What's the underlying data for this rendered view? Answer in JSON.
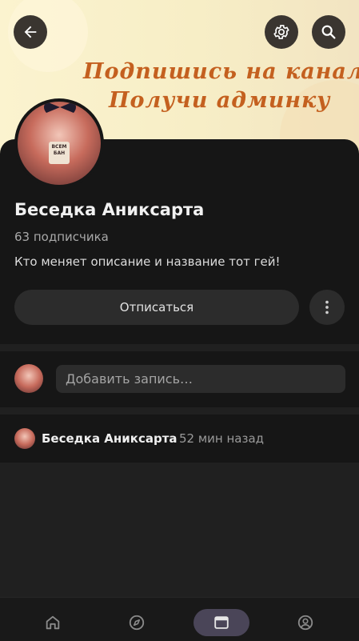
{
  "cover": {
    "line1": "Подпишись на канал",
    "line2": "Получи админку",
    "accent_color": "#c4601f"
  },
  "header": {
    "back_icon": "arrow-left-icon",
    "settings_icon": "gear-icon",
    "search_icon": "search-icon"
  },
  "profile": {
    "avatar_sign": "ВСЕМ БАН",
    "title": "Беседка Аниксарта",
    "subscribers": "63 подписчика",
    "description": "Кто меняет описание и название тот гей!",
    "unsubscribe_label": "Отписаться"
  },
  "composer": {
    "placeholder": "Добавить запись…"
  },
  "post": {
    "author": "Беседка Аниксарта",
    "time": "52 мин назад"
  },
  "bottom_nav": {
    "items": [
      "home-icon",
      "compass-icon",
      "channel-icon",
      "profile-icon"
    ],
    "active": "channel-icon",
    "active_color": "#4a4558"
  }
}
